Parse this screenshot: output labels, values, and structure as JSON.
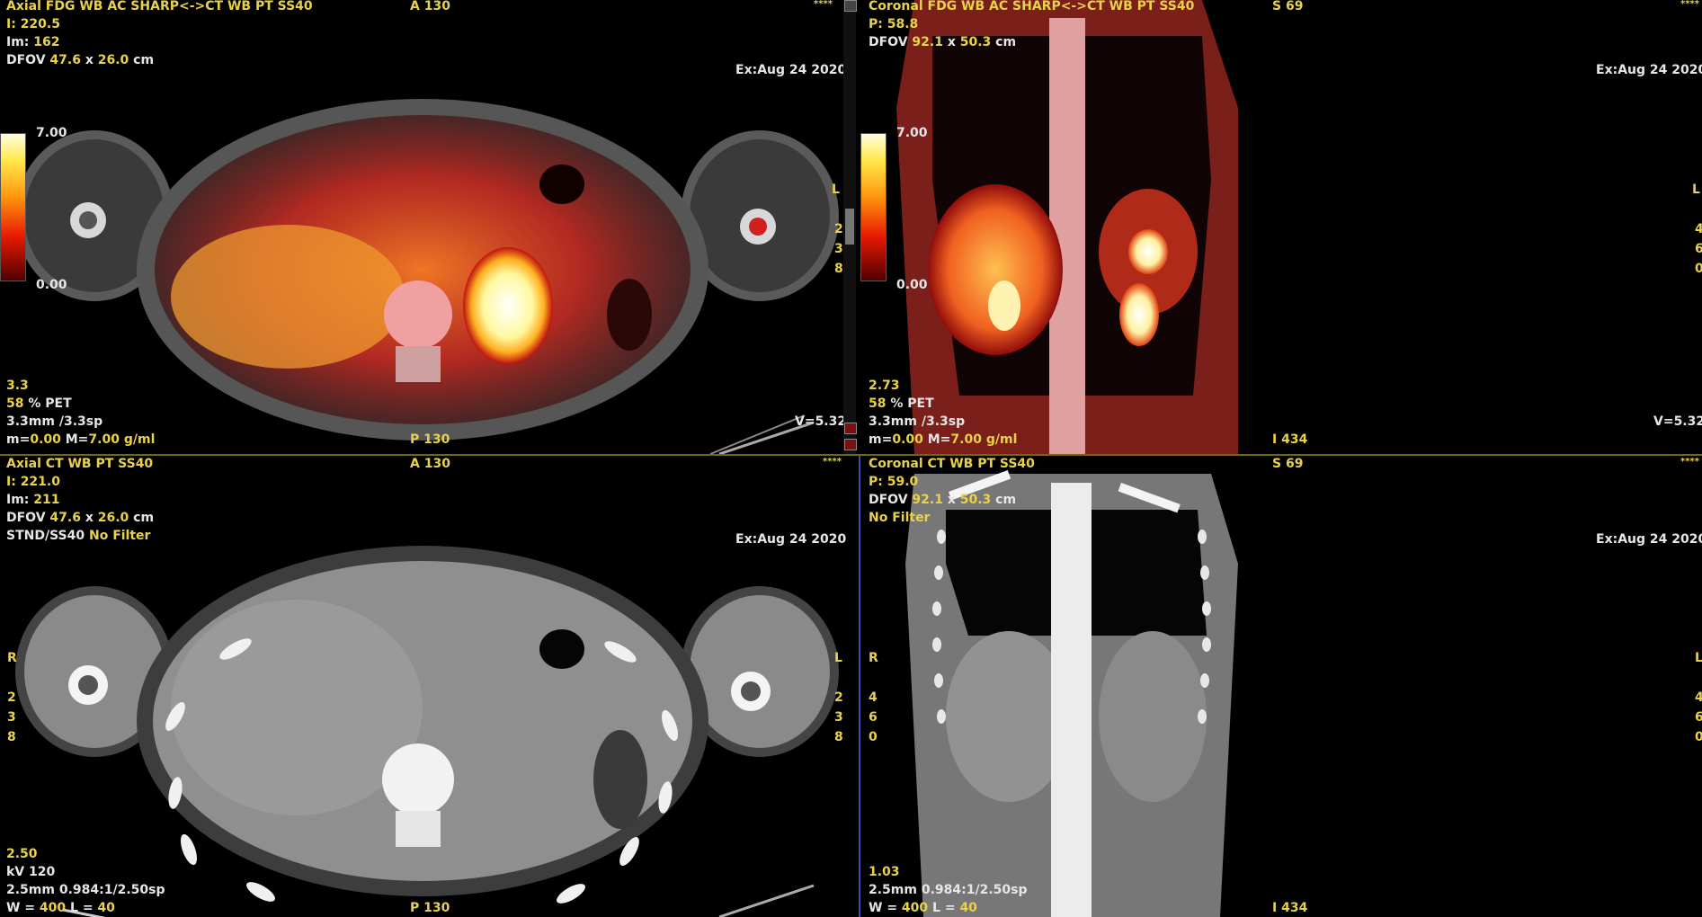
{
  "viewports": [
    {
      "id": "axial-fusion",
      "series": "Axial FDG WB AC SHARP<->CT WB PT SS40",
      "orient_top": "A 130",
      "stars": "****",
      "lines_left": [
        {
          "label": "I: ",
          "value": "220.5"
        },
        {
          "label": "Im: ",
          "value": "162"
        },
        {
          "label": "DFOV ",
          "value": "47.6",
          "mid": " x ",
          "value2": "26.0",
          "tail": " cm"
        }
      ],
      "exam_date": "Ex:Aug 24 2020",
      "colorbar_max": "7.00",
      "colorbar_min": "0.00",
      "side_right": "L",
      "side_right_digits": [
        "2",
        "3",
        "8"
      ],
      "bottom_left": [
        "3.3",
        "% PET",
        "3.3mm /3.3sp"
      ],
      "pet_pct": "58",
      "minmax": {
        "m_label": "m=",
        "m": "0.00",
        "M_label": " M=",
        "M": "7.00",
        "unit": " g/ml"
      },
      "orient_bottom": "P 130",
      "v_value": "V=5.32"
    },
    {
      "id": "coronal-fusion",
      "series": "Coronal FDG WB AC SHARP<->CT WB PT SS40",
      "orient_top": "S 69",
      "stars": "****",
      "lines_left": [
        {
          "label": "P: ",
          "value": "58.8"
        },
        {
          "label": "DFOV ",
          "value": "92.1",
          "mid": " x ",
          "value2": "50.3",
          "tail": " cm"
        }
      ],
      "exam_date": "Ex:Aug 24 2020",
      "colorbar_max": "7.00",
      "colorbar_min": "0.00",
      "side_right": "L",
      "side_right_digits": [
        "4",
        "6",
        "0"
      ],
      "bottom_left": [
        "2.73",
        "% PET",
        "3.3mm /3.3sp"
      ],
      "pet_pct": "58",
      "minmax": {
        "m_label": "m=",
        "m": "0.00",
        "M_label": " M=",
        "M": "7.00",
        "unit": " g/ml"
      },
      "orient_bottom": "I 434",
      "v_value": "V=5.32"
    },
    {
      "id": "axial-ct",
      "series": "Axial CT WB PT SS40",
      "orient_top": "A 130",
      "stars": "****",
      "lines_left": [
        {
          "label": "I: ",
          "value": "221.0"
        },
        {
          "label": "Im: ",
          "value": "211"
        },
        {
          "label": "DFOV ",
          "value": "47.6",
          "mid": " x ",
          "value2": "26.0",
          "tail": " cm"
        }
      ],
      "filter_label": "STND/SS40 ",
      "filter_value": "No Filter",
      "exam_date": "Ex:Aug 24 2020",
      "side_left": "R",
      "side_left_digits": [
        "2",
        "3",
        "8"
      ],
      "side_right": "L",
      "side_right_digits": [
        "2",
        "3",
        "8"
      ],
      "bottom_left": [
        "2.50",
        "kV 120",
        "2.5mm 0.984:1/2.50sp"
      ],
      "wl": {
        "w_label": "W = ",
        "w": "400",
        "l_label": " L = ",
        "l": "40"
      },
      "orient_bottom": "P 130"
    },
    {
      "id": "coronal-ct",
      "series": "Coronal CT WB PT SS40",
      "orient_top": "S 69",
      "stars": "****",
      "lines_left": [
        {
          "label": "P: ",
          "value": "59.0"
        },
        {
          "label": "DFOV ",
          "value": "92.1",
          "mid": " x ",
          "value2": "50.3",
          "tail": " cm"
        }
      ],
      "filter_value": "No Filter",
      "exam_date": "Ex:Aug 24 2020",
      "side_left": "R",
      "side_left_digits": [
        "4",
        "6",
        "0"
      ],
      "side_right": "L",
      "side_right_digits": [
        "4",
        "6",
        "0"
      ],
      "bottom_left": [
        "1.03",
        "2.5mm 0.984:1/2.50sp"
      ],
      "wl": {
        "w_label": "W = ",
        "w": "400",
        "l_label": " L = ",
        "l": "40"
      },
      "orient_bottom": "I 434"
    }
  ],
  "colors": {
    "overlay_yellow": "#e8d24a",
    "overlay_white": "#e6e6e6",
    "h_divider": "#6e6a10",
    "v_divider": "#3b4fa8"
  }
}
